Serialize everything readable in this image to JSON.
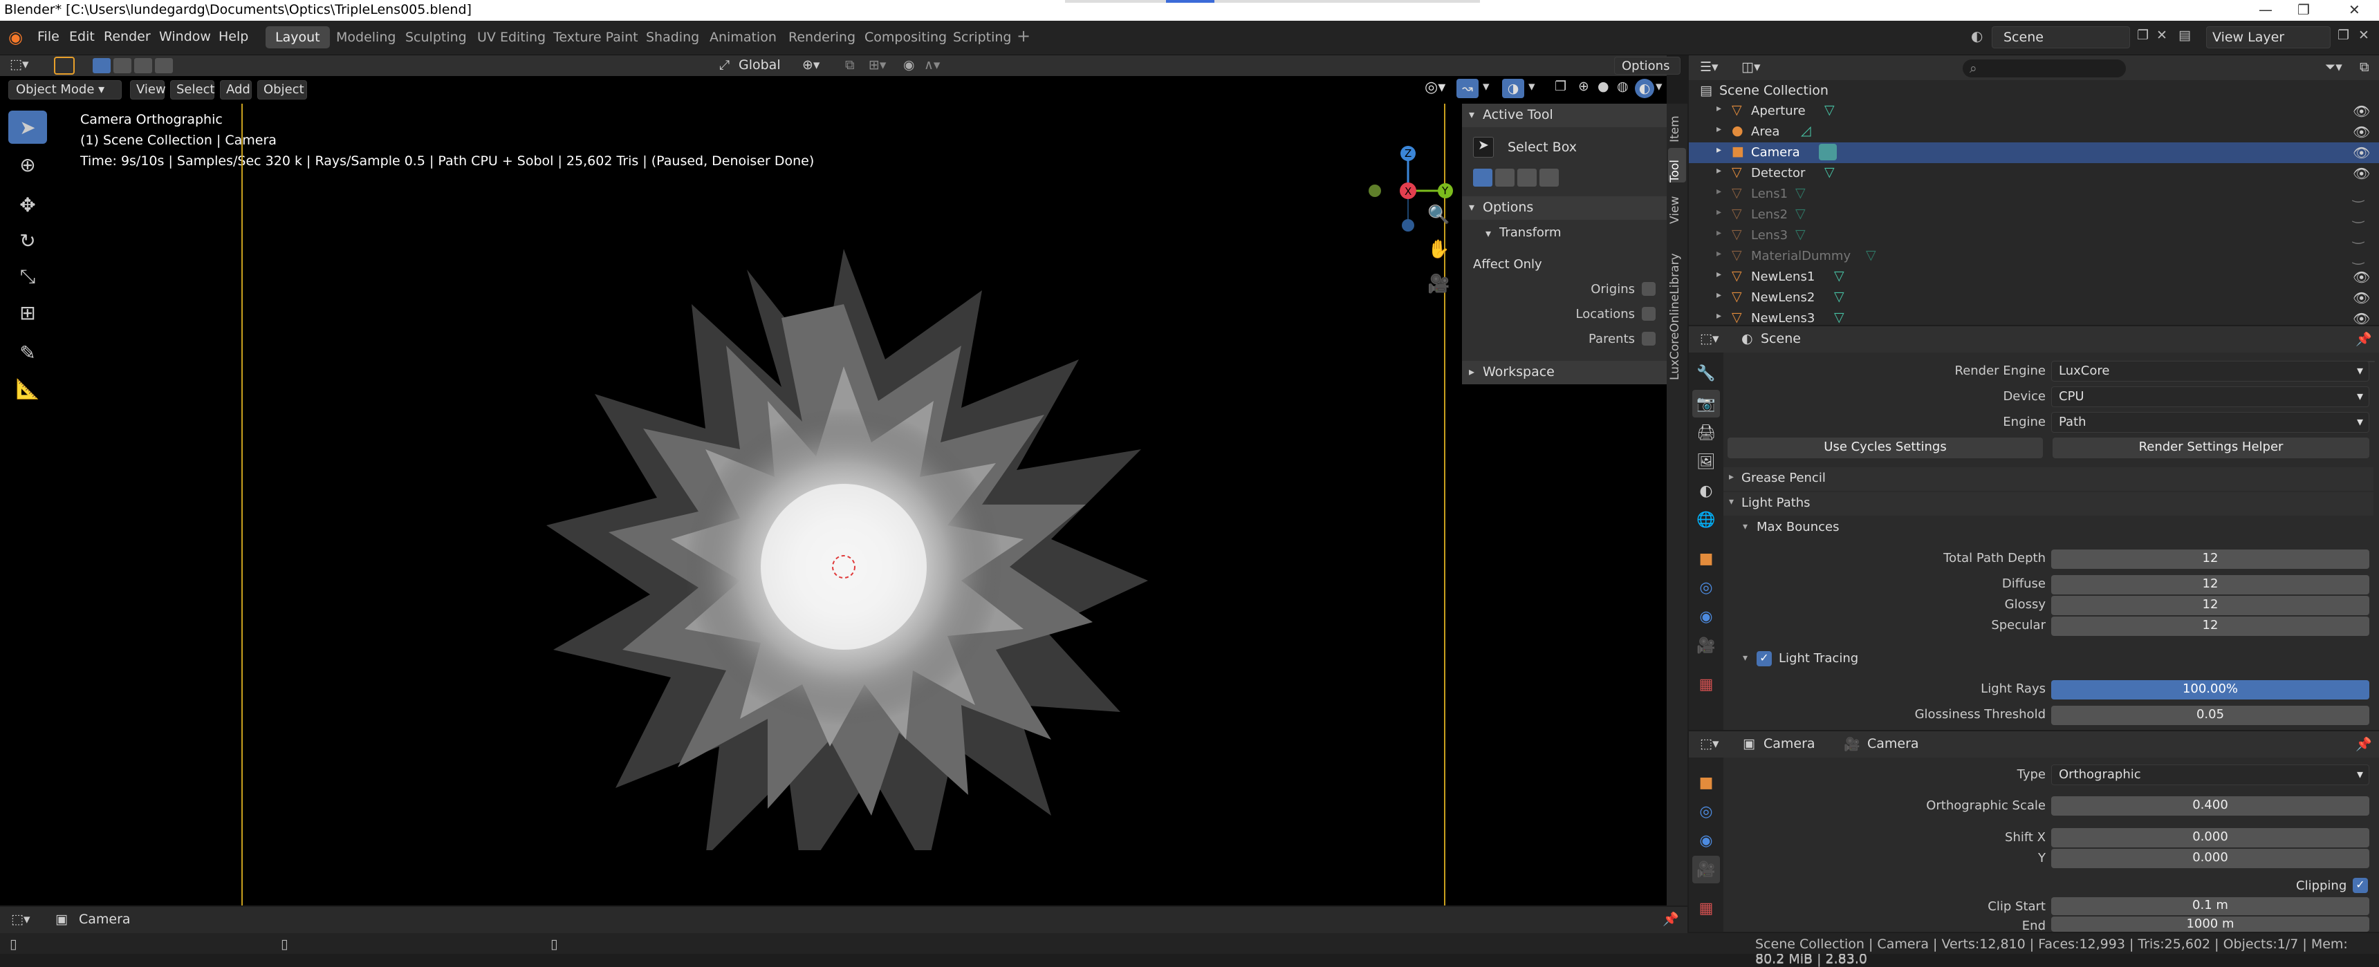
{
  "window": {
    "title": "Blender* [C:\\Users\\lundegardg\\Documents\\Optics\\TripleLens005.blend]"
  },
  "menu": [
    "File",
    "Edit",
    "Render",
    "Window",
    "Help"
  ],
  "workspaces": [
    "Layout",
    "Modeling",
    "Sculpting",
    "UV Editing",
    "Texture Paint",
    "Shading",
    "Animation",
    "Rendering",
    "Compositing",
    "Scripting"
  ],
  "topbar": {
    "scene": "Scene",
    "view_layer": "View Layer"
  },
  "viewport_header": {
    "transform": "Global",
    "options": "Options",
    "mode": "Object Mode",
    "menus": [
      "View",
      "Select",
      "Add",
      "Object"
    ]
  },
  "overlay": {
    "line1": "Camera Orthographic",
    "line2": "(1) Scene Collection | Camera",
    "line3": "Time: 9s/10s | Samples/Sec 320 k | Rays/Sample 0.5 | Path CPU + Sobol | 25,602 Tris | (Paused, Denoiser Done)"
  },
  "gizmo": {
    "x": "X",
    "y": "Y",
    "z": "Z"
  },
  "npanel": {
    "active_tool": "Active Tool",
    "select_box": "Select Box",
    "options": "Options",
    "transform": "Transform",
    "affect_only": "Affect Only",
    "origins": "Origins",
    "locations": "Locations",
    "parents": "Parents",
    "workspace": "Workspace",
    "tabs": [
      "Item",
      "Tool",
      "View",
      "LuxCoreOnlineLibrary"
    ]
  },
  "outliner": {
    "root": "Scene Collection",
    "items": [
      {
        "name": "Aperture",
        "dim": false,
        "eye": true
      },
      {
        "name": "Area",
        "dim": false,
        "eye": true
      },
      {
        "name": "Camera",
        "dim": false,
        "eye": true,
        "selected": true
      },
      {
        "name": "Detector",
        "dim": false,
        "eye": true
      },
      {
        "name": "Lens1",
        "dim": true,
        "eye": false
      },
      {
        "name": "Lens2",
        "dim": true,
        "eye": false
      },
      {
        "name": "Lens3",
        "dim": true,
        "eye": false
      },
      {
        "name": "MaterialDummy",
        "dim": true,
        "eye": false
      },
      {
        "name": "NewLens1",
        "dim": false,
        "eye": true
      },
      {
        "name": "NewLens2",
        "dim": false,
        "eye": true
      },
      {
        "name": "NewLens3",
        "dim": false,
        "eye": true
      }
    ]
  },
  "props1": {
    "header": "Scene",
    "render_engine_label": "Render Engine",
    "render_engine": "LuxCore",
    "device_label": "Device",
    "device": "CPU",
    "engine_label": "Engine",
    "engine": "Path",
    "use_cycles": "Use Cycles Settings",
    "helper": "Render Settings Helper",
    "grease_pencil": "Grease Pencil",
    "light_paths": "Light Paths",
    "max_bounces": "Max Bounces",
    "total_depth_label": "Total Path Depth",
    "total_depth": "12",
    "diffuse_label": "Diffuse",
    "diffuse": "12",
    "glossy_label": "Glossy",
    "glossy": "12",
    "specular_label": "Specular",
    "specular": "12",
    "light_tracing": "Light Tracing",
    "light_rays_label": "Light Rays",
    "light_rays": "100.00%",
    "glossiness_label": "Glossiness Threshold",
    "glossiness": "0.05"
  },
  "props2": {
    "obj": "Camera",
    "data": "Camera",
    "type_label": "Type",
    "type": "Orthographic",
    "ortho_label": "Orthographic Scale",
    "ortho": "0.400",
    "shiftx_label": "Shift X",
    "shiftx": "0.000",
    "y_label": "Y",
    "y": "0.000",
    "clipping": "Clipping",
    "clipstart_label": "Clip Start",
    "clipstart": "0.1 m",
    "end_label": "End",
    "end": "1000 m"
  },
  "timeline": {
    "label": "Camera"
  },
  "statusbar": "Scene Collection | Camera | Verts:12,810 | Faces:12,993 | Tris:25,602 | Objects:1/7 | Mem: 80.2 MiB | 2.83.0",
  "colors": {
    "accent": "#4772b3",
    "selection": "#334d80",
    "light_rays": "#4772b3",
    "gizmo_x": "#e33f4f",
    "gizmo_y": "#7cbc1d",
    "gizmo_z": "#3b86d8"
  }
}
